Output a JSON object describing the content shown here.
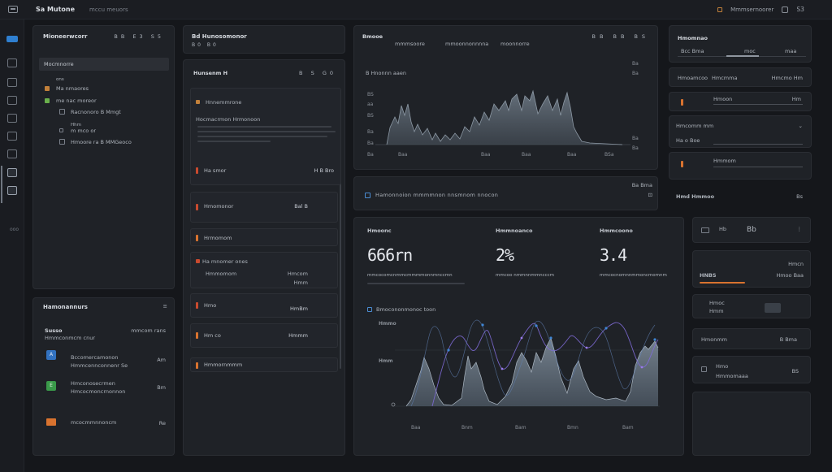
{
  "topbar": {
    "title": "Sa Mutone",
    "crumb": "mccu meuors",
    "account": "Mmmsernoorer",
    "notify": "S3"
  },
  "rail": {
    "items": [
      "home",
      "grid",
      "layers",
      "users",
      "sliders",
      "settings",
      "grid",
      "apps"
    ],
    "more_label": "ooo"
  },
  "left_panel": {
    "title": "Mioneerwcorr",
    "controls": [
      "BB",
      "E3",
      "S5"
    ],
    "search_value": "Mocmnorre",
    "tree_header": "ons",
    "tree": [
      {
        "icon": "S",
        "label": "Ma nmaores"
      },
      {
        "icon": "R",
        "label": "me nac moreor"
      },
      {
        "icon": "",
        "label": "Racnonoro B Mmgt"
      },
      {
        "icon": "",
        "label": "Hhm"
      },
      {
        "icon": "",
        "label": "m mco or"
      },
      {
        "icon": "",
        "label": "Hmoore ra B MMGeoco"
      }
    ]
  },
  "bottom_left_panel": {
    "title": "Hamonannurs",
    "section": "Susso",
    "section_link": "mmcom rans",
    "subtitle": "Hmmconmcm cnur",
    "items": [
      {
        "badge": "A",
        "title": "Bccomercamonon",
        "sub": "Hmmcennconnenr Se",
        "meta": "Am"
      },
      {
        "badge": "E",
        "title": "Hmconosecrmen",
        "sub": "Hmcocmoncrnonnon",
        "meta": "Bm"
      },
      {
        "badge": "",
        "title": "mcocmmnnoncm",
        "sub": "",
        "meta": "Re"
      }
    ]
  },
  "mid_col": {
    "header": "Bd Hunosomonor",
    "header_controls": [
      "B0",
      "B0"
    ],
    "card_title": "Hunsenm H",
    "card_controls": [
      "B",
      "S",
      "G0"
    ],
    "block_a": {
      "title": "Hnnemmrone",
      "link": "A Mamotomro"
    },
    "block_b_title": "Hocmacrmon Hrmonoon",
    "rows": [
      {
        "label": "Ha smor",
        "value": "H B Bro"
      },
      {
        "label": "Hmomonor",
        "value": "Bal B"
      },
      {
        "label": "Hrmomom",
        "value": ""
      },
      {
        "label": "Ha mnomer ones",
        "value": ""
      },
      {
        "label": "Hmmomom",
        "value": "Hmcom"
      },
      {
        "label": "Hmo",
        "value": "Hmm"
      },
      {
        "label": "Hm co",
        "value": "HmBm"
      },
      {
        "label": "Hmmornmmm",
        "value": "Hmmm"
      }
    ]
  },
  "main_chart": {
    "title": "Bmooe",
    "tabs": [
      "mmmsoore",
      "mmoonnonnnna",
      "moonnorre"
    ],
    "controls": [
      "BB",
      "BB",
      "BS"
    ],
    "subtitle": "B Hnonnn aaen",
    "x_labels": [
      "Ba",
      "Baa",
      "Baa",
      "Baa",
      "Baa",
      "BSa"
    ],
    "y_labels": [
      "BS",
      "aa",
      "BS",
      "Ba",
      "Ba"
    ],
    "right_labels": [
      "Ba",
      "Ba",
      "Ba",
      "Ba"
    ]
  },
  "banner": {
    "text": "Hamonnoion mmmmnon nnsmnom nnocon",
    "right": "Ba Bma"
  },
  "stats": {
    "kpis": [
      {
        "label": "Hmoonc",
        "value": "666rn",
        "sub": "mmcocomcnmmcmmmmonnmnccmn"
      },
      {
        "label": "Hmmnoanco",
        "value": "2%",
        "sub": "mmcoo nmmnnmmncccm"
      },
      {
        "label": "Hmmcoono",
        "value": "3.4",
        "sub": "mmcocnomnnmmoncmomnm"
      }
    ],
    "chart_title": "Bmocononmonoc toon",
    "chart_y_labels": [
      "Hmmo",
      "Hmm"
    ],
    "chart_x_labels": [
      "Baa",
      "Bnm",
      "Bam",
      "Bmn",
      "Bam"
    ]
  },
  "right_col": {
    "panel1": {
      "title": "Hmomnao",
      "tabs": [
        "Bcc Bma",
        "moc",
        "maa"
      ]
    },
    "row1": {
      "label": "Hmoamcoo",
      "mid": "Hmcmma",
      "right": "Hmcmo Hm"
    },
    "row2": {
      "label": "Hmoon",
      "value": "Hm"
    },
    "row3": {
      "label": "Hmcomm mm",
      "value": ""
    },
    "row4": {
      "label": "Ha o Boe",
      "value": ""
    },
    "row5": {
      "label": "Hmmom",
      "value": ""
    },
    "row6": {
      "label": "Hmd Hmmoo",
      "value": "Bs"
    }
  },
  "right_lower": {
    "card1": {
      "left": "Hb",
      "mid": "Hmmo",
      "right": "Bb"
    },
    "card2": {
      "left": "HNBS",
      "mid": "Hmcn",
      "right": "Hmoo Baa"
    },
    "card3": {
      "left": "Hmoc",
      "mid": "Hmm"
    },
    "card4": {
      "label": "Hmonmm",
      "value": "B Bma"
    },
    "card5": {
      "title": "Hmo",
      "sub": "Hmmomaaa",
      "right": "BS"
    }
  }
}
